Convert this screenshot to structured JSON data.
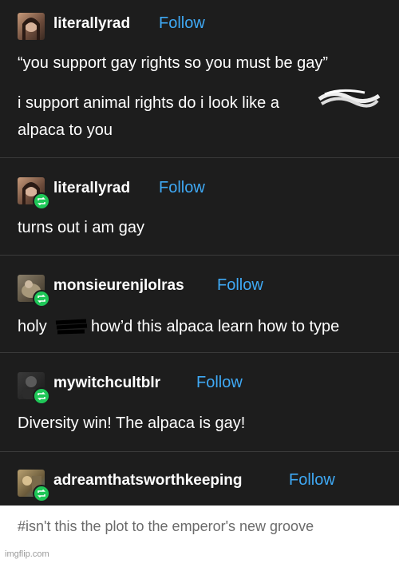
{
  "posts": [
    {
      "username": "literallyrad",
      "follow": "Follow",
      "lines": [
        "“you support gay rights so you must be gay”",
        "i support animal rights do i look like a",
        "alpaca to you"
      ]
    },
    {
      "username": "literallyrad",
      "follow": "Follow",
      "lines": [
        "turns out i am gay"
      ]
    },
    {
      "username": "monsieurenjlolras",
      "follow": "Follow",
      "line_a": "holy",
      "line_b": "how’d this alpaca learn how to type"
    },
    {
      "username": "mywitchcultblr",
      "follow": "Follow",
      "lines": [
        "Diversity win! The alpaca is gay!"
      ]
    },
    {
      "username": "adreamthatsworthkeeping",
      "follow": "Follow"
    }
  ],
  "tags": "#isn't this the plot to the emperor's new groove",
  "watermark": "imgflip.com",
  "colors": {
    "background": "#1d1d1d",
    "follow": "#3fa9f5",
    "reblog_badge": "#1fc758",
    "tag_text": "#6b6b6b"
  },
  "icons": {
    "reblog": "reblog-icon",
    "avatar": "avatar"
  }
}
